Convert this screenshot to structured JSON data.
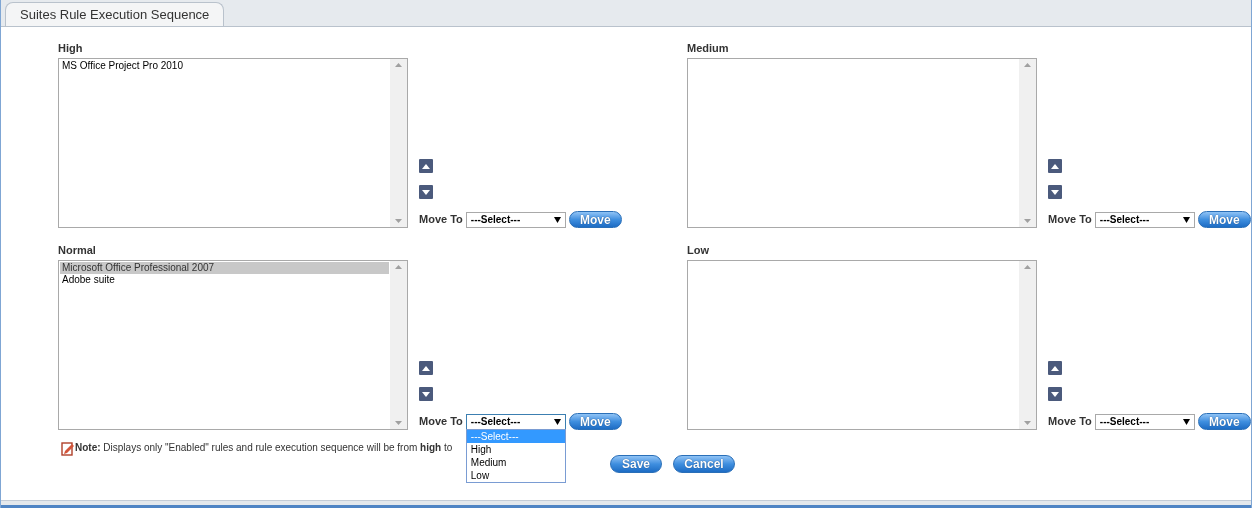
{
  "tab": {
    "label": "Suites Rule Execution Sequence",
    "selected": true
  },
  "panels": [
    {
      "title": "High",
      "items": [
        {
          "text": "MS Office Project Pro 2010",
          "selected": false
        }
      ],
      "move_label": "Move To",
      "select": {
        "value": "---Select---",
        "expanded": false
      },
      "move_button": "Move"
    },
    {
      "title": "Medium",
      "move_label": "Move To",
      "select": {
        "value": "---Select---",
        "expanded": false
      },
      "move_button": "Move"
    },
    {
      "title": "Normal",
      "items": [
        {
          "text": "Microsoft Office Professional 2007",
          "selected": true
        },
        {
          "text": "Adobe suite",
          "selected": false
        }
      ],
      "move_label": "Move To",
      "select": {
        "value": "---Select---",
        "expanded": true,
        "options": [
          {
            "label": "---Select---",
            "selected": true
          },
          {
            "label": "High",
            "selected": false
          },
          {
            "label": "Medium",
            "selected": false
          },
          {
            "label": "Low",
            "selected": false
          }
        ]
      },
      "move_button": "Move"
    },
    {
      "title": "Low",
      "move_label": "Move To",
      "select": {
        "value": "---Select---",
        "expanded": false
      },
      "move_button": "Move"
    }
  ],
  "note": "**Note:** Displays only \"Enabled\" rules and rule execution sequence will be from **high** to",
  "buttons": [
    "Save",
    "Cancel"
  ]
}
